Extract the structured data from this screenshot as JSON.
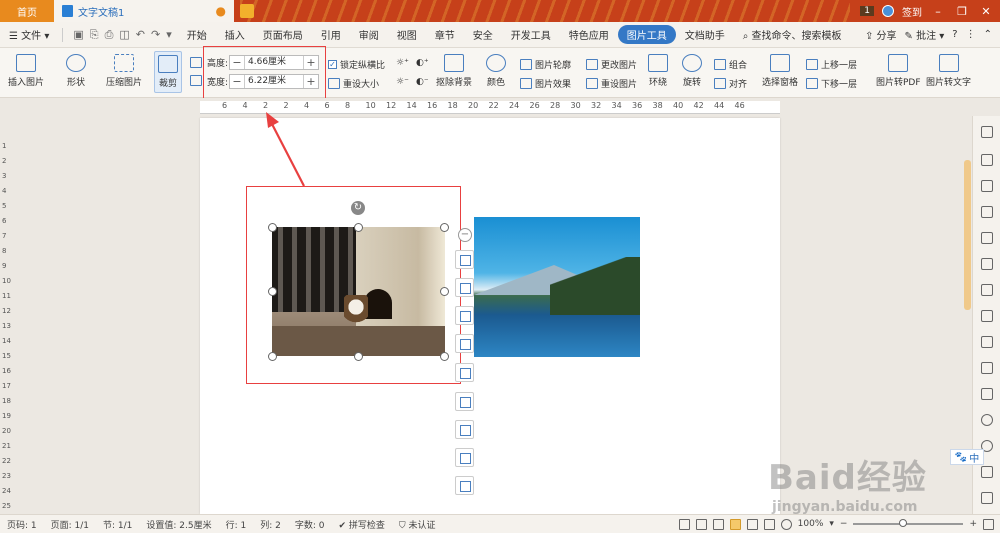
{
  "titlebar": {
    "home_tab": "首页",
    "doc_tab": "文字文稿1",
    "modified_dot": "●",
    "badge_num": "1",
    "user_label": "签到"
  },
  "menubar": {
    "file": "文件",
    "tabs": [
      "开始",
      "插入",
      "页面布局",
      "引用",
      "审阅",
      "视图",
      "章节",
      "安全",
      "开发工具",
      "特色应用",
      "图片工具",
      "文档助手"
    ],
    "active_tab": "图片工具",
    "search": "查找命令、搜索模板",
    "share": "分享",
    "comment": "批注"
  },
  "ribbon": {
    "insert_picture": "插入图片",
    "shape": "形状",
    "compress": "压缩图片",
    "crop": "裁剪",
    "height_label": "高度:",
    "height_value": "4.66厘米",
    "width_label": "宽度:",
    "width_value": "6.22厘米",
    "lock_ratio": "锁定纵横比",
    "reset_size": "重设大小",
    "remove_bg": "抠除背景",
    "color": "颜色",
    "outline": "图片轮廓",
    "effects": "图片效果",
    "change_picture": "更改图片",
    "reset_picture": "重设图片",
    "wrap": "环绕",
    "rotate": "旋转",
    "group": "组合",
    "align": "对齐",
    "select_pane": "选择窗格",
    "bring_forward": "上移一层",
    "send_backward": "下移一层",
    "to_pdf": "图片转PDF",
    "to_text": "图片转文字"
  },
  "ruler": {
    "h_ticks": [
      "6",
      "4",
      "2",
      "2",
      "4",
      "6",
      "8",
      "10",
      "12",
      "14",
      "16",
      "18",
      "20",
      "22",
      "24",
      "26",
      "28",
      "30",
      "32",
      "34",
      "36",
      "38",
      "40",
      "42",
      "44",
      "46"
    ],
    "v_ticks": [
      "1",
      "2",
      "3",
      "4",
      "5",
      "6",
      "7",
      "8",
      "9",
      "10",
      "11",
      "12",
      "13",
      "14",
      "15",
      "16",
      "17",
      "18",
      "19",
      "20",
      "21",
      "22",
      "23",
      "24",
      "25"
    ]
  },
  "sidebar": {
    "lang": "中"
  },
  "watermark": {
    "main": "Baid经验",
    "sub": "jingyan.baidu.com"
  },
  "statusbar": {
    "page_num": "页码: 1",
    "pages": "页面: 1/1",
    "section": "节: 1/1",
    "setting": "设置值: 2.5厘米",
    "row": "行: 1",
    "col": "列: 2",
    "words": "字数: 0",
    "spellcheck": "拼写检查",
    "auth": "未认证",
    "zoom": "100%"
  },
  "colors": {
    "accent": "#3478c6",
    "title_bar": "#c6401a",
    "highlight_red": "#e84040"
  }
}
